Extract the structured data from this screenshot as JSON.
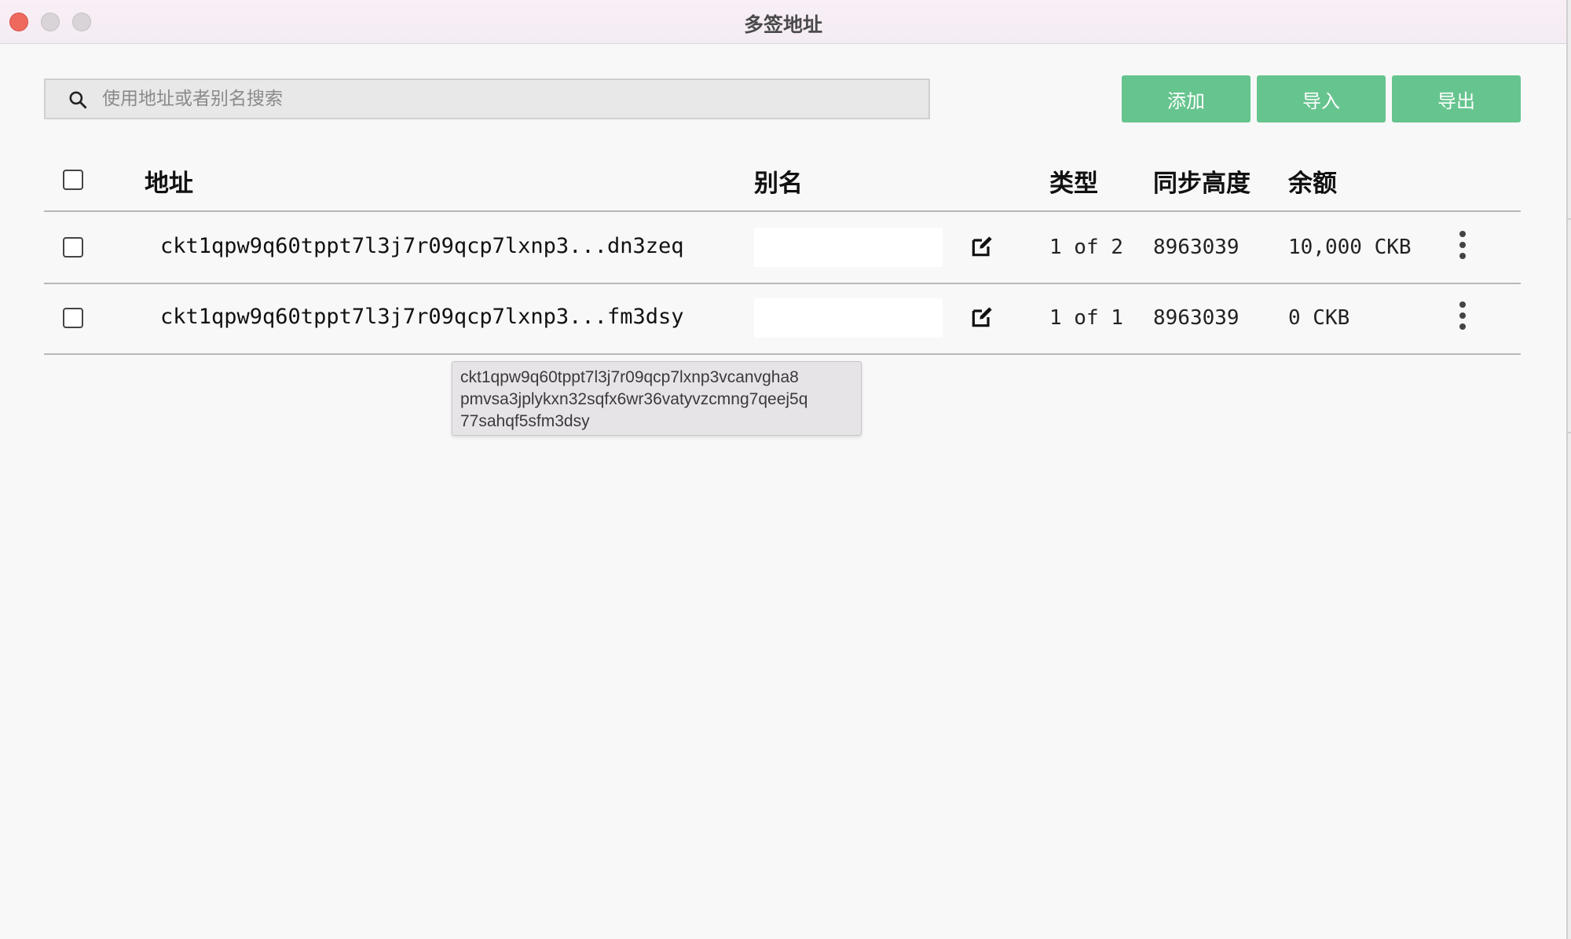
{
  "window": {
    "title": "多签地址"
  },
  "search": {
    "placeholder": "使用地址或者别名搜索",
    "icon": "search-icon"
  },
  "toolbar": {
    "add_label": "添加",
    "import_label": "导入",
    "export_label": "导出",
    "accent": "#66c48e"
  },
  "table": {
    "headers": {
      "address": "地址",
      "alias": "别名",
      "type": "类型",
      "sync_height": "同步高度",
      "balance": "余额"
    },
    "rows": [
      {
        "address": "ckt1qpw9q60tppt7l3j7r09qcp7lxnp3...dn3zeq",
        "alias": "",
        "type": "1 of 2",
        "sync_height": "8963039",
        "balance": "10,000 CKB"
      },
      {
        "address": "ckt1qpw9q60tppt7l3j7r09qcp7lxnp3...fm3dsy",
        "alias": "",
        "type": "1 of 1",
        "sync_height": "8963039",
        "balance": "0 CKB"
      }
    ]
  },
  "tooltip": {
    "lines": [
      "ckt1qpw9q60tppt7l3j7r09qcp7lxnp3vcanvgha8",
      "pmvsa3jplykxn32sqfx6wr36vatyvzcmng7qeej5q",
      "77sahqf5sfm3dsy"
    ]
  }
}
